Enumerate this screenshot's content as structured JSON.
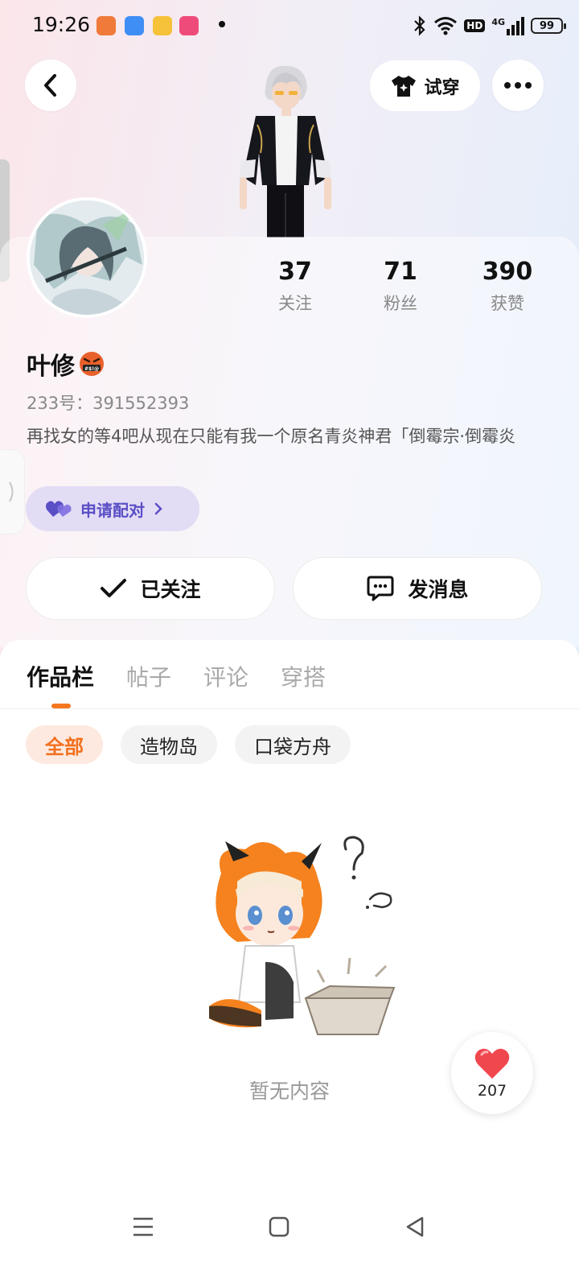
{
  "status_bar": {
    "time": "19:26",
    "battery": "99",
    "network": "4G",
    "hd": "HD",
    "icons": [
      "bluetooth-icon",
      "wifi-icon",
      "signal-icon",
      "battery-icon"
    ]
  },
  "header": {
    "tryon_label": "试穿"
  },
  "profile": {
    "name": "叶修",
    "uid_text": "233号：391552393",
    "bio": "再找女的等4吧从现在只能有我一个原名青炎神君「倒霉宗·倒霉炎",
    "match_label": "申请配对"
  },
  "stats": [
    {
      "value": "37",
      "label": "关注"
    },
    {
      "value": "71",
      "label": "粉丝"
    },
    {
      "value": "390",
      "label": "获赞"
    }
  ],
  "actions": {
    "follow_label": "已关注",
    "message_label": "发消息"
  },
  "tabs": [
    "作品栏",
    "帖子",
    "评论",
    "穿搭"
  ],
  "chips": [
    "全部",
    "造物岛",
    "口袋方舟"
  ],
  "empty_text": "暂无内容",
  "like_fab": {
    "count": "207"
  },
  "colors": {
    "accent_orange": "#f26f1c",
    "match_purple": "#5a4fc6",
    "heart_red": "#f0474f"
  }
}
